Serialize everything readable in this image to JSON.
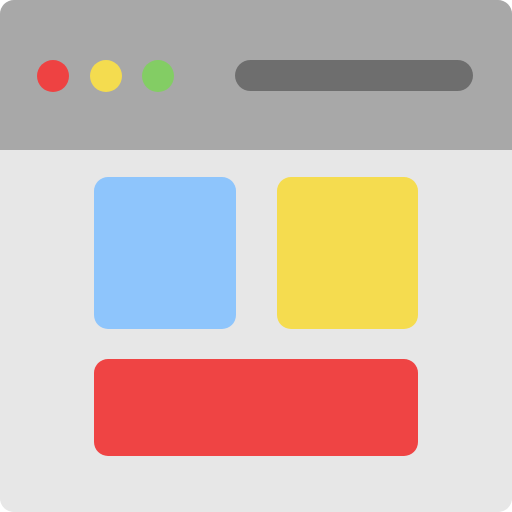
{
  "window": {
    "frame_color": "#e7e7e7",
    "titlebar_color": "#a8a8a8",
    "controls": [
      {
        "name": "close",
        "color": "#ee4242"
      },
      {
        "name": "minimize",
        "color": "#f4dc4f"
      },
      {
        "name": "maximize",
        "color": "#83cd64"
      }
    ],
    "address_bar": {
      "color": "#6e6e6e",
      "value": ""
    }
  },
  "content": {
    "tiles": [
      {
        "name": "blue-tile",
        "color": "#8ec5fc"
      },
      {
        "name": "yellow-tile",
        "color": "#f5dc4f"
      }
    ],
    "banner": {
      "color": "#ef4444"
    }
  }
}
